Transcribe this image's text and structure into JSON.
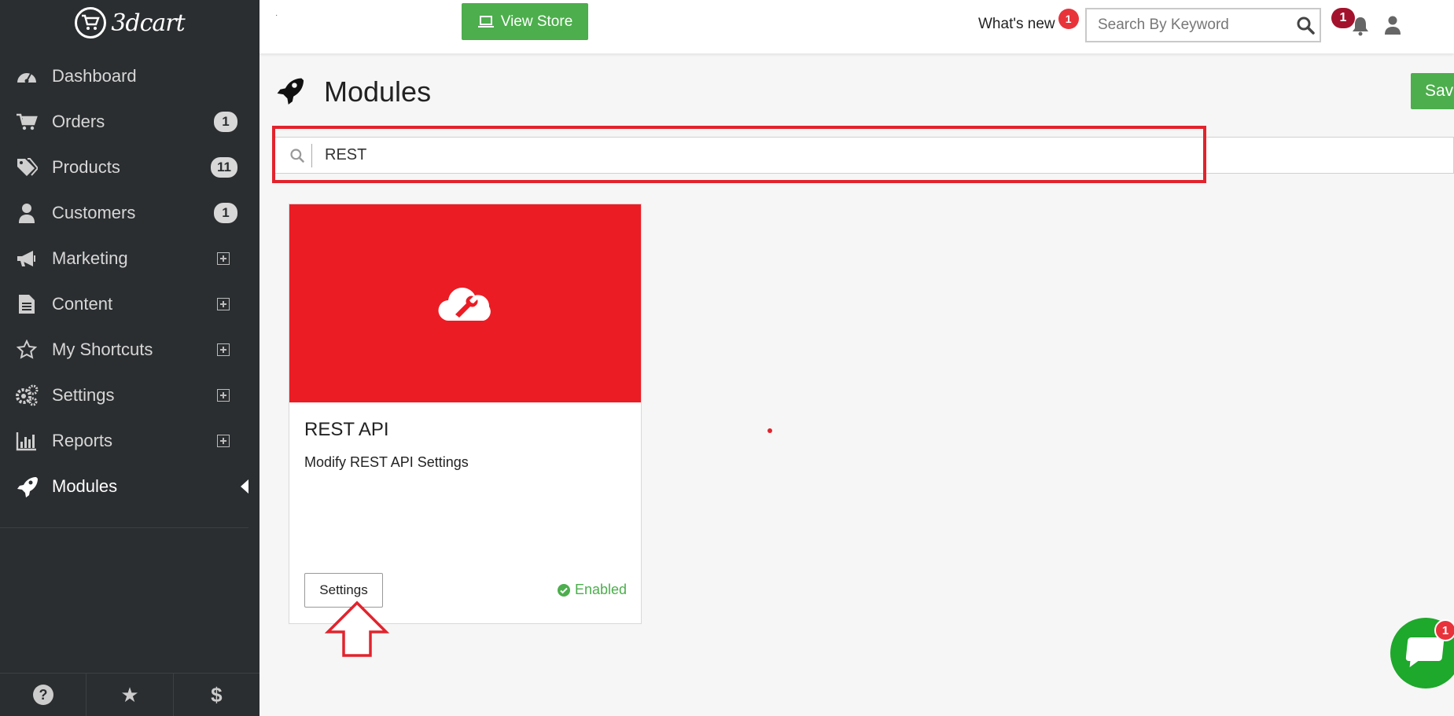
{
  "brand": {
    "logo_text": "3dcart"
  },
  "sidebar": {
    "items": [
      {
        "label": "Dashboard",
        "icon": "dashboard-icon"
      },
      {
        "label": "Orders",
        "icon": "cart-icon",
        "badge": "1"
      },
      {
        "label": "Products",
        "icon": "tags-icon",
        "badge": "11"
      },
      {
        "label": "Customers",
        "icon": "user-icon",
        "badge": "1"
      },
      {
        "label": "Marketing",
        "icon": "megaphone-icon",
        "expandable": true
      },
      {
        "label": "Content",
        "icon": "document-icon",
        "expandable": true
      },
      {
        "label": "My Shortcuts",
        "icon": "star-icon",
        "expandable": true
      },
      {
        "label": "Settings",
        "icon": "gears-icon",
        "expandable": true
      },
      {
        "label": "Reports",
        "icon": "bar-chart-icon",
        "expandable": true
      },
      {
        "label": "Modules",
        "icon": "rocket-icon",
        "active": true
      }
    ],
    "footer": [
      "help-icon",
      "star-icon",
      "dollar-icon"
    ],
    "footer_glyphs": [
      "?",
      "★",
      "$"
    ]
  },
  "topbar": {
    "dot_text": "·",
    "view_store_label": "View Store",
    "whats_new_label": "What's new",
    "whats_new_count": "1",
    "search_placeholder": "Search By Keyword",
    "notification_count": "1"
  },
  "main": {
    "title": "Modules",
    "save_label": "Save",
    "search_value": "REST"
  },
  "card": {
    "title": "REST API",
    "description": "Modify REST API Settings",
    "settings_label": "Settings",
    "status": "Enabled",
    "banner_color": "#ec1c24"
  },
  "chat": {
    "badge": "1"
  },
  "colors": {
    "sidebar_bg": "#2b2e30",
    "accent_green": "#4cae4c",
    "annotation_red": "#e2232d"
  }
}
